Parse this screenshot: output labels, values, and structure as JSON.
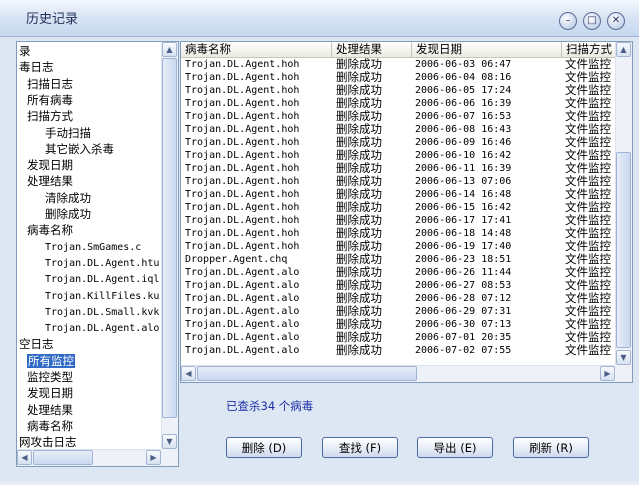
{
  "window": {
    "title": "历史记录"
  },
  "tree": {
    "items": [
      {
        "label": "录",
        "indent": 0
      },
      {
        "label": "毒日志",
        "indent": 0
      },
      {
        "label": "扫描日志",
        "indent": 1
      },
      {
        "label": "所有病毒",
        "indent": 1
      },
      {
        "label": "扫描方式",
        "indent": 1
      },
      {
        "label": "手动扫描",
        "indent": 2
      },
      {
        "label": "其它嵌入杀毒",
        "indent": 2
      },
      {
        "label": "发现日期",
        "indent": 1
      },
      {
        "label": "处理结果",
        "indent": 1
      },
      {
        "label": "清除成功",
        "indent": 2
      },
      {
        "label": "删除成功",
        "indent": 2
      },
      {
        "label": "病毒名称",
        "indent": 1
      },
      {
        "label": "Trojan.SmGames.c",
        "indent": 2,
        "mono": true
      },
      {
        "label": "Trojan.DL.Agent.htu",
        "indent": 2,
        "mono": true
      },
      {
        "label": "Trojan.DL.Agent.iql",
        "indent": 2,
        "mono": true
      },
      {
        "label": "Trojan.KillFiles.ku",
        "indent": 2,
        "mono": true
      },
      {
        "label": "Trojan.DL.Small.kvk",
        "indent": 2,
        "mono": true
      },
      {
        "label": "Trojan.DL.Agent.alo",
        "indent": 2,
        "mono": true
      },
      {
        "label": "空日志",
        "indent": 0
      },
      {
        "label": "所有监控",
        "indent": 1,
        "selected": true
      },
      {
        "label": "监控类型",
        "indent": 1
      },
      {
        "label": "发现日期",
        "indent": 1
      },
      {
        "label": "处理结果",
        "indent": 1
      },
      {
        "label": "病毒名称",
        "indent": 1
      },
      {
        "label": "网攻击日志",
        "indent": 0
      }
    ]
  },
  "list": {
    "columns": [
      "病毒名称",
      "处理结果",
      "发现日期",
      "扫描方式"
    ],
    "rows": [
      [
        "Trojan.DL.Agent.hoh",
        "删除成功",
        "2006-06-03 06:47",
        "文件监控"
      ],
      [
        "Trojan.DL.Agent.hoh",
        "删除成功",
        "2006-06-04 08:16",
        "文件监控"
      ],
      [
        "Trojan.DL.Agent.hoh",
        "删除成功",
        "2006-06-05 17:24",
        "文件监控"
      ],
      [
        "Trojan.DL.Agent.hoh",
        "删除成功",
        "2006-06-06 16:39",
        "文件监控"
      ],
      [
        "Trojan.DL.Agent.hoh",
        "删除成功",
        "2006-06-07 16:53",
        "文件监控"
      ],
      [
        "Trojan.DL.Agent.hoh",
        "删除成功",
        "2006-06-08 16:43",
        "文件监控"
      ],
      [
        "Trojan.DL.Agent.hoh",
        "删除成功",
        "2006-06-09 16:46",
        "文件监控"
      ],
      [
        "Trojan.DL.Agent.hoh",
        "删除成功",
        "2006-06-10 16:42",
        "文件监控"
      ],
      [
        "Trojan.DL.Agent.hoh",
        "删除成功",
        "2006-06-11 16:39",
        "文件监控"
      ],
      [
        "Trojan.DL.Agent.hoh",
        "删除成功",
        "2006-06-13 07:06",
        "文件监控"
      ],
      [
        "Trojan.DL.Agent.hoh",
        "删除成功",
        "2006-06-14 16:48",
        "文件监控"
      ],
      [
        "Trojan.DL.Agent.hoh",
        "删除成功",
        "2006-06-15 16:42",
        "文件监控"
      ],
      [
        "Trojan.DL.Agent.hoh",
        "删除成功",
        "2006-06-17 17:41",
        "文件监控"
      ],
      [
        "Trojan.DL.Agent.hoh",
        "删除成功",
        "2006-06-18 14:48",
        "文件监控"
      ],
      [
        "Trojan.DL.Agent.hoh",
        "删除成功",
        "2006-06-19 17:40",
        "文件监控"
      ],
      [
        "Dropper.Agent.chq",
        "删除成功",
        "2006-06-23 18:51",
        "文件监控"
      ],
      [
        "Trojan.DL.Agent.alo",
        "删除成功",
        "2006-06-26 11:44",
        "文件监控"
      ],
      [
        "Trojan.DL.Agent.alo",
        "删除成功",
        "2006-06-27 08:53",
        "文件监控"
      ],
      [
        "Trojan.DL.Agent.alo",
        "删除成功",
        "2006-06-28 07:12",
        "文件监控"
      ],
      [
        "Trojan.DL.Agent.alo",
        "删除成功",
        "2006-06-29 07:31",
        "文件监控"
      ],
      [
        "Trojan.DL.Agent.alo",
        "删除成功",
        "2006-06-30 07:13",
        "文件监控"
      ],
      [
        "Trojan.DL.Agent.alo",
        "删除成功",
        "2006-07-01 20:35",
        "文件监控"
      ],
      [
        "Trojan.DL.Agent.alo",
        "删除成功",
        "2006-07-02 07:55",
        "文件监控"
      ]
    ]
  },
  "summary": "已查杀34 个病毒",
  "buttons": {
    "delete": "删除 (D)",
    "find": "查找 (F)",
    "export": "导出 (E)",
    "refresh": "刷新 (R)"
  }
}
